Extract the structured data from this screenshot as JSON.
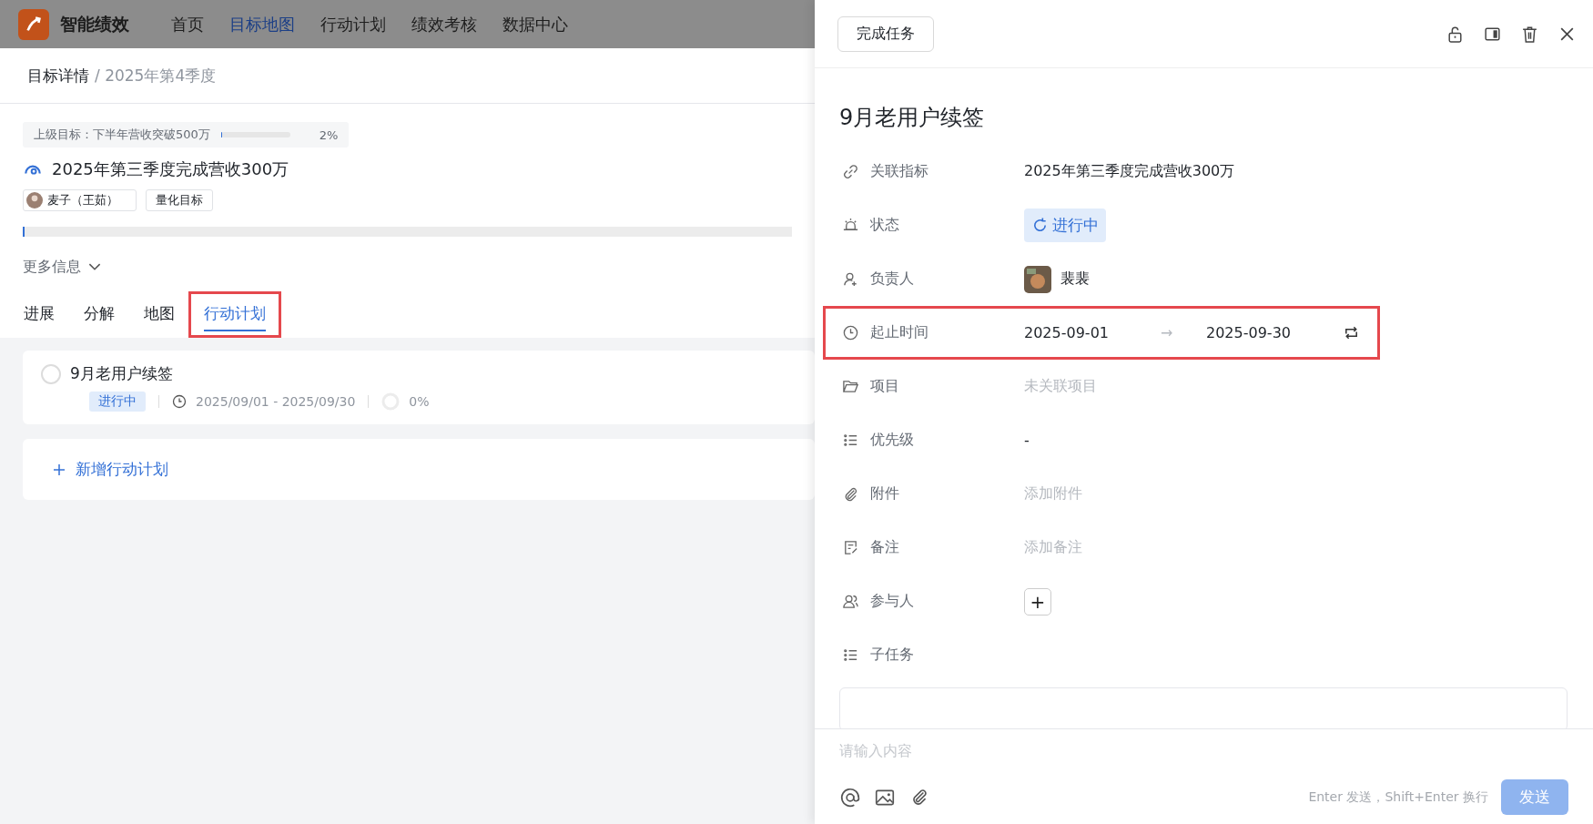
{
  "app": {
    "name": "智能绩效",
    "nav": [
      {
        "label": "首页",
        "selected": false
      },
      {
        "label": "目标地图",
        "selected": true
      },
      {
        "label": "行动计划",
        "selected": false
      },
      {
        "label": "绩效考核",
        "selected": false
      },
      {
        "label": "数据中心",
        "selected": false
      }
    ]
  },
  "breadcrumb": {
    "current": "目标详情",
    "sub": "/ 2025年第4季度"
  },
  "goal": {
    "parent": {
      "label": "上级目标：下半年营收突破500万",
      "level": 0.02,
      "percent": "2%"
    },
    "title": "2025年第三季度完成营收300万",
    "owner": "麦子（王茹）",
    "tag": "量化目标",
    "level": 0.002,
    "more": "更多信息"
  },
  "tabs": [
    {
      "label": "进展",
      "selected": false,
      "highlighted": false
    },
    {
      "label": "分解",
      "selected": false,
      "highlighted": false
    },
    {
      "label": "地图",
      "selected": false,
      "highlighted": false
    },
    {
      "label": "行动计划",
      "selected": true,
      "highlighted": true
    }
  ],
  "plans": [
    {
      "title": "9月老用户续签",
      "done": false,
      "status": "进行中",
      "dates": "2025/09/01 - 2025/09/30",
      "percent": "0%"
    }
  ],
  "add_plan": "新增行动计划",
  "task": {
    "complete_button": "完成任务",
    "title": "9月老用户续签",
    "fields": [
      {
        "kind": "text",
        "label": "关联指标",
        "value": "2025年第三季度完成营收300万",
        "highlighted": false
      },
      {
        "kind": "status",
        "label": "状态",
        "value": "进行中",
        "highlighted": false
      },
      {
        "kind": "person",
        "label": "负责人",
        "value": "裴裴",
        "highlighted": false
      },
      {
        "kind": "range",
        "label": "起止时间",
        "start": "2025-09-01",
        "arrow": "→",
        "end": "2025-09-30",
        "highlighted": true
      },
      {
        "kind": "empty",
        "label": "项目",
        "placeholder": "未关联项目",
        "highlighted": false
      },
      {
        "kind": "text",
        "label": "优先级",
        "value": "-",
        "highlighted": false
      },
      {
        "kind": "empty",
        "label": "附件",
        "placeholder": "添加附件",
        "highlighted": false
      },
      {
        "kind": "empty",
        "label": "备注",
        "placeholder": "添加备注",
        "highlighted": false
      },
      {
        "kind": "add",
        "label": "参与人",
        "value": "+",
        "highlighted": false
      },
      {
        "kind": "header",
        "label": "子任务",
        "highlighted": false
      }
    ]
  },
  "composer": {
    "placeholder": "请输入内容",
    "hint": "Enter 发送，Shift+Enter 换行",
    "send": "发送"
  }
}
